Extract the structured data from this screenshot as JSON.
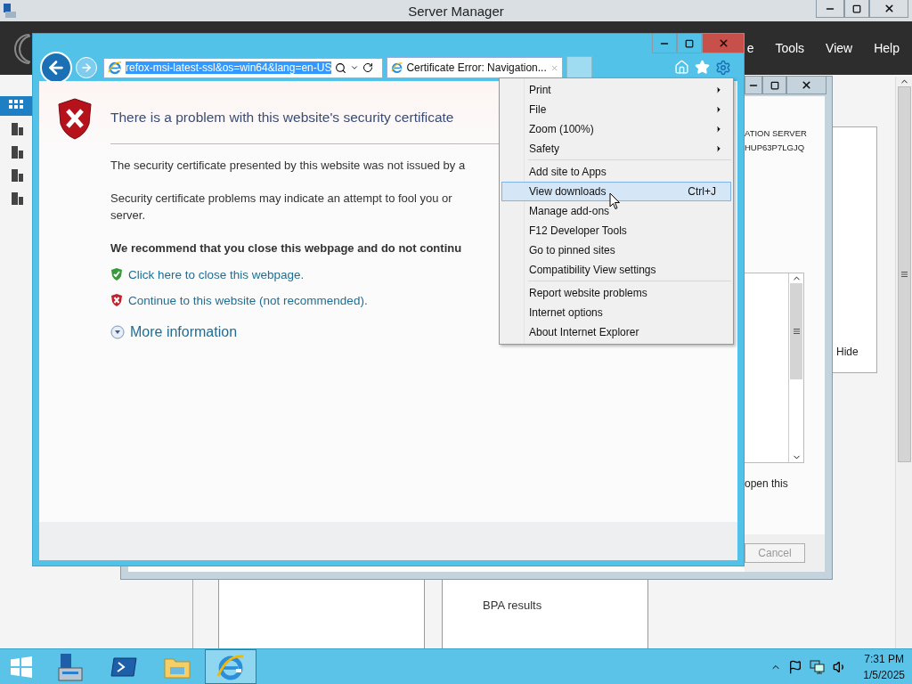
{
  "server_manager": {
    "title": "Server Manager",
    "menu": [
      {
        "label": "e"
      },
      {
        "label": "Tools"
      },
      {
        "label": "View"
      },
      {
        "label": "Help"
      }
    ],
    "sidebar_items": [
      {
        "selected": true
      },
      {
        "selected": false
      },
      {
        "selected": false
      },
      {
        "selected": false
      },
      {
        "selected": false
      }
    ],
    "tiles": [
      {
        "label": "BPA results"
      }
    ],
    "side_button": "Hide"
  },
  "dialog": {
    "lines": [
      "ATION SERVER",
      "HUP63P7LGJQ"
    ],
    "note": "open this",
    "cancel": {
      "label": "Cancel",
      "disabled": true
    }
  },
  "browser": {
    "address": "refox-msi-latest-ssl&os=win64&lang=en-US",
    "tab": "Certificate Error: Navigation...",
    "heading": "There is a problem with this website's security certificate",
    "paragraphs": [
      [
        "The security certificate presented by this website was not issued by a"
      ],
      [
        "Security certificate problems may indicate an attempt to fool you or",
        "server."
      ]
    ],
    "recommendation": "We recommend that you close this webpage and do not continu",
    "links": [
      {
        "kind": "safe",
        "text": "Click here to close this webpage."
      },
      {
        "kind": "unsafe",
        "text": "Continue to this website (not recommended)."
      }
    ],
    "more": "More information"
  },
  "tools_menu": [
    [
      {
        "label": "Print",
        "submenu": true,
        "selected": false
      },
      {
        "label": "File",
        "submenu": true,
        "selected": false
      },
      {
        "label": "Zoom (100%)",
        "submenu": true,
        "selected": false
      },
      {
        "label": "Safety",
        "submenu": true,
        "selected": false
      }
    ],
    [
      {
        "label": "Add site to Apps",
        "submenu": false,
        "selected": false
      },
      {
        "label": "View downloads",
        "submenu": false,
        "selected": true,
        "shortcut": "Ctrl+J"
      },
      {
        "label": "Manage add-ons",
        "submenu": false,
        "selected": false
      },
      {
        "label": "F12 Developer Tools",
        "submenu": false,
        "selected": false
      },
      {
        "label": "Go to pinned sites",
        "submenu": false,
        "selected": false
      },
      {
        "label": "Compatibility View settings",
        "submenu": false,
        "selected": false
      }
    ],
    [
      {
        "label": "Report website problems",
        "submenu": false,
        "selected": false
      },
      {
        "label": "Internet options",
        "submenu": false,
        "selected": false
      },
      {
        "label": "About Internet Explorer",
        "submenu": false,
        "selected": false
      }
    ]
  ],
  "taskbar": {
    "apps": [
      {
        "kind": "server-manager",
        "selected": false
      },
      {
        "kind": "powershell",
        "selected": false
      },
      {
        "kind": "explorer",
        "selected": false
      },
      {
        "kind": "browser",
        "selected": true
      }
    ],
    "time": "7:31 PM",
    "date": "1/5/2025"
  }
}
